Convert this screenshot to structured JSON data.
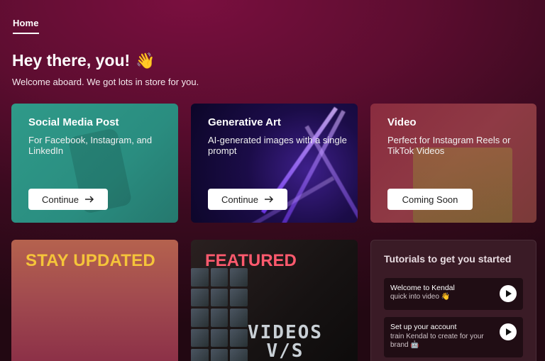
{
  "nav": {
    "home_tab": "Home"
  },
  "hero": {
    "greeting": "Hey there, you!",
    "wave_emoji": "👋",
    "subtitle": "Welcome aboard. We got lots in store for you."
  },
  "cards": {
    "social": {
      "title": "Social Media Post",
      "description": "For Facebook, Instagram, and LinkedIn",
      "button_label": "Continue",
      "accent": "#2f9a89"
    },
    "art": {
      "title": "Generative Art",
      "description": "AI-generated images with a single prompt",
      "button_label": "Continue",
      "accent": "#3d1f8a"
    },
    "video": {
      "title": "Video",
      "description": "Perfect for Instagram Reels or TikTok Videos",
      "button_label": "Coming Soon",
      "accent": "#8a2c3f"
    },
    "stay_updated": {
      "title": "STAY UPDATED",
      "accent": "#f5c43a"
    },
    "featured": {
      "title": "FEATURED",
      "accent": "#ff5a6e",
      "banner_line1": "VIDEOS",
      "banner_line2": "V/S"
    }
  },
  "tutorials": {
    "title": "Tutorials to get you started",
    "items": [
      {
        "title": "Welcome to Kendal",
        "subtitle": "quick into video 👋"
      },
      {
        "title": "Set up your account",
        "subtitle": "train Kendal to create for your brand 🤖"
      }
    ]
  },
  "icons": {
    "arrow": "arrow-right-icon",
    "play": "play-icon"
  }
}
